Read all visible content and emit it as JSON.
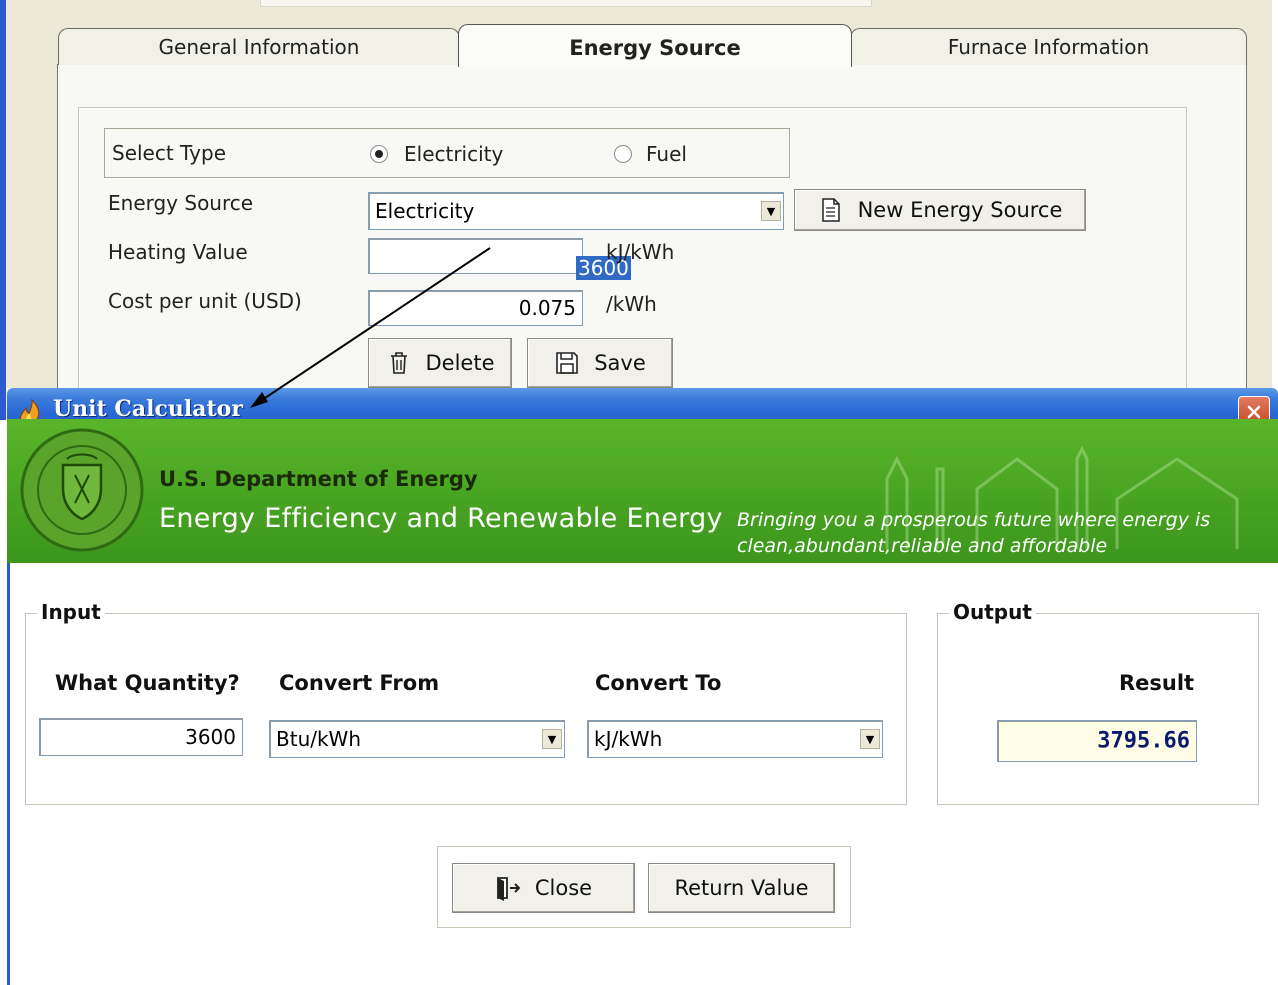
{
  "background_window": {
    "tabs": [
      {
        "label": "General Information"
      },
      {
        "label": "Energy Source"
      },
      {
        "label": "Furnace Information"
      }
    ],
    "select_type": {
      "label": "Select Type",
      "options": [
        "Electricity",
        "Fuel"
      ],
      "selected": "Electricity"
    },
    "energy_source": {
      "label": "Energy Source",
      "value": "Electricity"
    },
    "new_energy_source_button": "New Energy Source",
    "heating_value": {
      "label": "Heating Value",
      "value": "3600",
      "unit": "kJ/kWh"
    },
    "cost_per_unit": {
      "label": "Cost per unit (USD)",
      "value": "0.075",
      "unit": "/kWh"
    },
    "delete_button": "Delete",
    "save_button": "Save"
  },
  "dialog": {
    "title": "Unit Calculator",
    "banner": {
      "department": "U.S. Department of Energy",
      "office": "Energy Efficiency and Renewable Energy",
      "tagline_line1": "Bringing you a prosperous future where energy is",
      "tagline_line2": "clean,abundant,reliable and affordable"
    },
    "input": {
      "legend": "Input",
      "quantity_label": "What Quantity?",
      "quantity_value": "3600",
      "from_label": "Convert From",
      "from_value": "Btu/kWh",
      "to_label": "Convert To",
      "to_value": "kJ/kWh"
    },
    "output": {
      "legend": "Output",
      "result_label": "Result",
      "result_value": "3795.66"
    },
    "close_button": "Close",
    "return_button": "Return Value"
  },
  "colors": {
    "titlebar": "#2866d4",
    "banner_green": "#4aa523",
    "result_bg": "#fffde6",
    "result_text": "#0a1a6e",
    "selection": "#316ac5"
  }
}
